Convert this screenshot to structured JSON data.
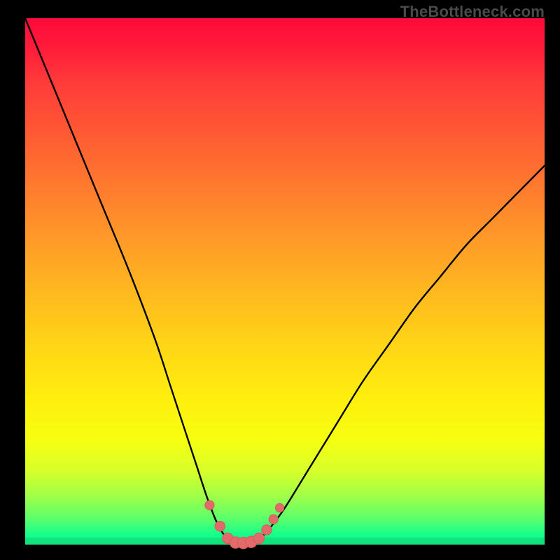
{
  "watermark": "TheBottleneck.com",
  "colors": {
    "frame": "#000000",
    "curve": "#000000",
    "marker_fill": "#e26a6a",
    "marker_stroke": "#d85a5a",
    "green_band": "#13e37f"
  },
  "chart_data": {
    "type": "line",
    "title": "",
    "xlabel": "",
    "ylabel": "",
    "xlim": [
      0,
      100
    ],
    "ylim": [
      0,
      100
    ],
    "x": [
      0,
      5,
      10,
      15,
      20,
      25,
      28,
      31,
      33,
      35,
      37,
      39,
      41,
      43,
      45,
      47,
      50,
      55,
      60,
      65,
      70,
      75,
      80,
      85,
      90,
      95,
      100
    ],
    "y": [
      100,
      88,
      76,
      64,
      52,
      39,
      30,
      21,
      15,
      9,
      4,
      1,
      0,
      0,
      1,
      3,
      7,
      15,
      23,
      31,
      38,
      45,
      51,
      57,
      62,
      67,
      72
    ],
    "markers": {
      "x": [
        35.5,
        37.5,
        39.0,
        40.5,
        42.0,
        43.5,
        45.0,
        46.5,
        47.8,
        49.0
      ],
      "y": [
        7.5,
        3.5,
        1.2,
        0.4,
        0.3,
        0.5,
        1.2,
        2.8,
        4.8,
        7.0
      ],
      "size": [
        12,
        13,
        14,
        15,
        15,
        15,
        14,
        13,
        12,
        11
      ]
    }
  }
}
